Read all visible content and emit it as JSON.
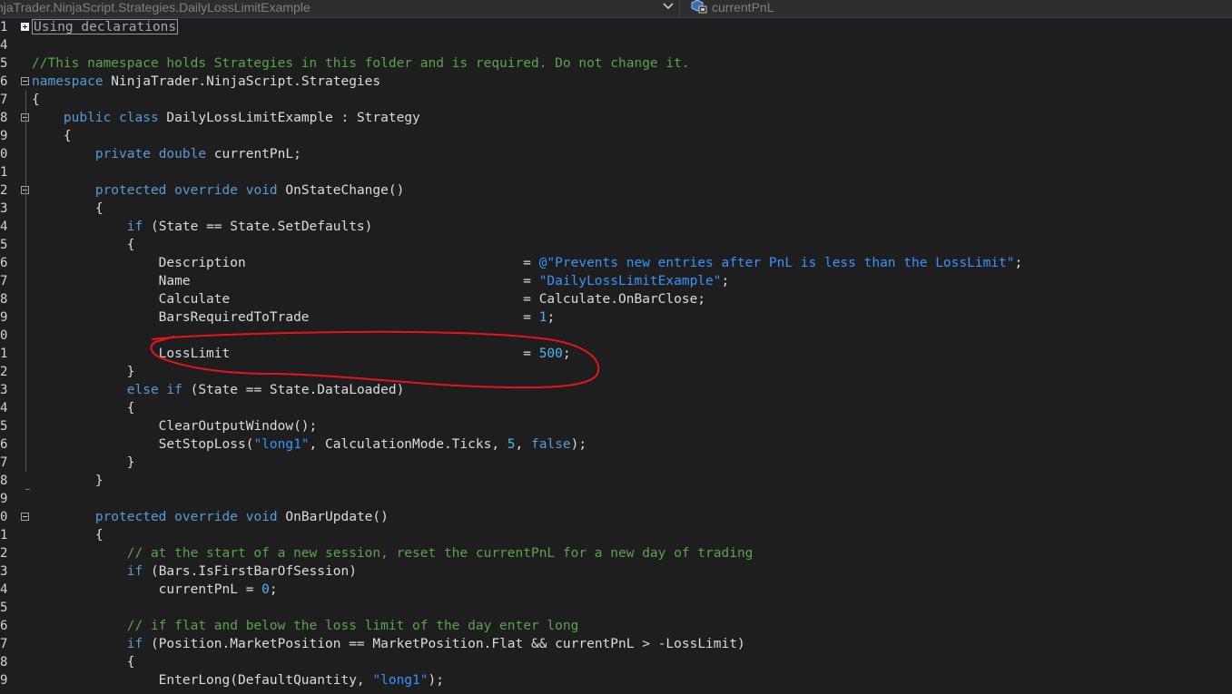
{
  "nav": {
    "type_selector": "njaTrader.NinjaScript.Strategies.DailyLossLimitExample",
    "member_selector": "currentPnL"
  },
  "lines": [
    {
      "n": "1",
      "fold": "plus",
      "tokens": [],
      "collapsed": "Using declarations"
    },
    {
      "n": "4",
      "tokens": []
    },
    {
      "n": "5",
      "tokens": [
        {
          "t": "//This namespace holds Strategies in this folder and is required. Do not change it.",
          "c": "cm"
        }
      ]
    },
    {
      "n": "6",
      "fold": "minus",
      "tokens": [
        {
          "t": "namespace",
          "c": "kw"
        },
        {
          "t": " NinjaTrader.NinjaScript.Strategies"
        }
      ]
    },
    {
      "n": "7",
      "tokens": [
        {
          "t": "{"
        }
      ]
    },
    {
      "n": "8",
      "fold": "minus",
      "tokens": [
        {
          "t": "    "
        },
        {
          "t": "public",
          "c": "kw"
        },
        {
          "t": " "
        },
        {
          "t": "class",
          "c": "kw"
        },
        {
          "t": " DailyLossLimitExample : Strategy"
        }
      ]
    },
    {
      "n": "9",
      "tokens": [
        {
          "t": "    {"
        }
      ]
    },
    {
      "n": "0",
      "tokens": [
        {
          "t": "        "
        },
        {
          "t": "private",
          "c": "kw"
        },
        {
          "t": " "
        },
        {
          "t": "double",
          "c": "kw"
        },
        {
          "t": " currentPnL;"
        }
      ]
    },
    {
      "n": "1",
      "tokens": []
    },
    {
      "n": "2",
      "fold": "minus",
      "tokens": [
        {
          "t": "        "
        },
        {
          "t": "protected",
          "c": "kw"
        },
        {
          "t": " "
        },
        {
          "t": "override",
          "c": "kw"
        },
        {
          "t": " "
        },
        {
          "t": "void",
          "c": "kw"
        },
        {
          "t": " OnStateChange()"
        }
      ]
    },
    {
      "n": "3",
      "tokens": [
        {
          "t": "        {"
        }
      ]
    },
    {
      "n": "4",
      "tokens": [
        {
          "t": "            "
        },
        {
          "t": "if",
          "c": "kw"
        },
        {
          "t": " (State == State.SetDefaults)"
        }
      ]
    },
    {
      "n": "5",
      "tokens": [
        {
          "t": "            {"
        }
      ]
    },
    {
      "n": "6",
      "tokens": [
        {
          "t": "                Description                                   = "
        },
        {
          "t": "@\"Prevents new entries after PnL is less than the LossLimit\"",
          "c": "st"
        },
        {
          "t": ";"
        }
      ]
    },
    {
      "n": "7",
      "tokens": [
        {
          "t": "                Name                                          = "
        },
        {
          "t": "\"DailyLossLimitExample\"",
          "c": "st"
        },
        {
          "t": ";"
        }
      ]
    },
    {
      "n": "8",
      "tokens": [
        {
          "t": "                Calculate                                     = Calculate.OnBarClose;"
        }
      ]
    },
    {
      "n": "9",
      "tokens": [
        {
          "t": "                BarsRequiredToTrade                           = "
        },
        {
          "t": "1",
          "c": "nu"
        },
        {
          "t": ";"
        }
      ]
    },
    {
      "n": "0",
      "tokens": []
    },
    {
      "n": "1",
      "tokens": [
        {
          "t": "                LossLimit                                     = "
        },
        {
          "t": "500",
          "c": "nu"
        },
        {
          "t": ";"
        }
      ]
    },
    {
      "n": "2",
      "tokens": [
        {
          "t": "            }"
        }
      ]
    },
    {
      "n": "3",
      "tokens": [
        {
          "t": "            "
        },
        {
          "t": "else",
          "c": "kw"
        },
        {
          "t": " "
        },
        {
          "t": "if",
          "c": "kw"
        },
        {
          "t": " (State == State.DataLoaded)"
        }
      ]
    },
    {
      "n": "4",
      "tokens": [
        {
          "t": "            {"
        }
      ]
    },
    {
      "n": "5",
      "tokens": [
        {
          "t": "                ClearOutputWindow();"
        }
      ]
    },
    {
      "n": "6",
      "tokens": [
        {
          "t": "                SetStopLoss("
        },
        {
          "t": "\"long1\"",
          "c": "st"
        },
        {
          "t": ", CalculationMode.Ticks, "
        },
        {
          "t": "5",
          "c": "nu"
        },
        {
          "t": ", "
        },
        {
          "t": "false",
          "c": "kw"
        },
        {
          "t": ");"
        }
      ]
    },
    {
      "n": "7",
      "tokens": [
        {
          "t": "            }"
        }
      ]
    },
    {
      "n": "8",
      "tokens": [
        {
          "t": "        }"
        }
      ]
    },
    {
      "n": "9",
      "tokens": []
    },
    {
      "n": "0",
      "fold": "minus",
      "tokens": [
        {
          "t": "        "
        },
        {
          "t": "protected",
          "c": "kw"
        },
        {
          "t": " "
        },
        {
          "t": "override",
          "c": "kw"
        },
        {
          "t": " "
        },
        {
          "t": "void",
          "c": "kw"
        },
        {
          "t": " OnBarUpdate()"
        }
      ]
    },
    {
      "n": "1",
      "tokens": [
        {
          "t": "        {"
        }
      ]
    },
    {
      "n": "2",
      "tokens": [
        {
          "t": "            // at the start of a new session, reset the currentPnL for a new day of trading",
          "c": "cm"
        }
      ]
    },
    {
      "n": "3",
      "tokens": [
        {
          "t": "            "
        },
        {
          "t": "if",
          "c": "kw"
        },
        {
          "t": " (Bars.IsFirstBarOfSession)"
        }
      ]
    },
    {
      "n": "4",
      "tokens": [
        {
          "t": "                currentPnL = "
        },
        {
          "t": "0",
          "c": "nu"
        },
        {
          "t": ";"
        }
      ]
    },
    {
      "n": "5",
      "tokens": []
    },
    {
      "n": "6",
      "tokens": [
        {
          "t": "            // if flat and below the loss limit of the day enter long",
          "c": "cm"
        }
      ]
    },
    {
      "n": "7",
      "tokens": [
        {
          "t": "            "
        },
        {
          "t": "if",
          "c": "kw"
        },
        {
          "t": " (Position.MarketPosition == MarketPosition.Flat && currentPnL > -LossLimit)"
        }
      ]
    },
    {
      "n": "8",
      "tokens": [
        {
          "t": "            {"
        }
      ]
    },
    {
      "n": "9",
      "tokens": [
        {
          "t": "                EnterLong(DefaultQuantity, "
        },
        {
          "t": "\"long1\"",
          "c": "st"
        },
        {
          "t": ");"
        }
      ]
    }
  ],
  "colors": {
    "background": "#1e1e1e",
    "keyword": "#569cd6",
    "comment": "#57a64a",
    "string": "#3794ff",
    "number": "#4fb6f0",
    "annotation": "#e8141c"
  },
  "icons": {
    "type_dropdown": "chevron-down-icon",
    "member": "private-field-icon",
    "fold_expand": "plus-box-icon",
    "fold_collapse": "minus-box-icon"
  }
}
